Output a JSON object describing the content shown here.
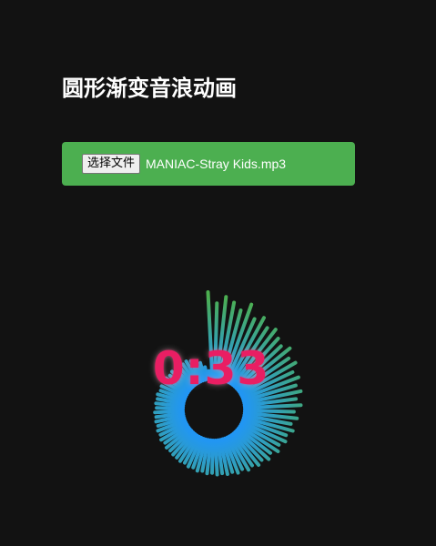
{
  "page": {
    "title": "圆形渐变音浪动画"
  },
  "file_input": {
    "button_label": "选择文件",
    "file_name": "MANIAC-Stray Kids.mp3"
  },
  "player": {
    "time": "0:33"
  },
  "visualizer": {
    "gradient_inner": "#2196f3",
    "gradient_outer": "#4caf50",
    "levels": [
      0.95,
      0.82,
      0.9,
      0.85,
      0.78,
      0.88,
      0.74,
      0.8,
      0.72,
      0.76,
      0.7,
      0.66,
      0.72,
      0.64,
      0.68,
      0.6,
      0.64,
      0.58,
      0.62,
      0.55,
      0.6,
      0.52,
      0.56,
      0.5,
      0.54,
      0.48,
      0.5,
      0.45,
      0.48,
      0.42,
      0.45,
      0.4,
      0.42,
      0.38,
      0.4,
      0.36,
      0.38,
      0.35,
      0.36,
      0.34,
      0.35,
      0.33,
      0.34,
      0.32,
      0.33,
      0.31,
      0.32,
      0.3,
      0.31,
      0.3,
      0.3,
      0.29,
      0.3,
      0.28,
      0.3,
      0.28,
      0.29,
      0.27,
      0.28,
      0.27,
      0.28,
      0.26,
      0.27,
      0.26,
      0.27,
      0.25,
      0.26,
      0.25,
      0.26,
      0.24,
      0.25,
      0.24,
      0.25,
      0.23,
      0.24,
      0.22,
      0.2,
      0.16,
      0.1,
      0.05
    ]
  },
  "colors": {
    "background": "#121212",
    "button_bar": "#4caf50",
    "time_text": "#e91e63"
  }
}
